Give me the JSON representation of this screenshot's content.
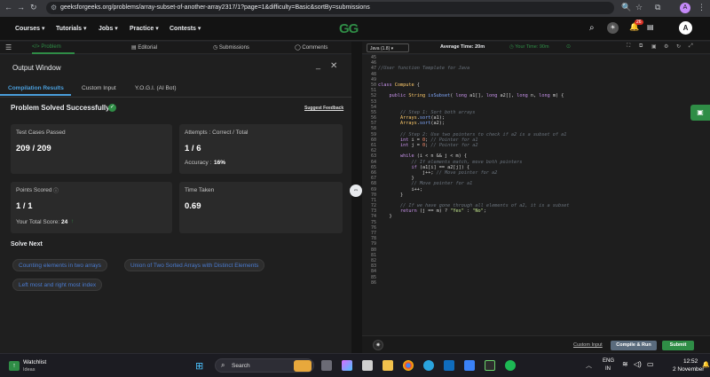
{
  "browser": {
    "url": "geeksforgeeks.org/problems/array-subset-of-another-array2317/1?page=1&difficulty=Basic&sortBy=submissions",
    "profile_initial": "A"
  },
  "site": {
    "logo": "GG",
    "menu": [
      "Courses",
      "Tutorials",
      "Jobs",
      "Practice",
      "Contests"
    ],
    "notification_count": "26",
    "avatar": "A"
  },
  "problem_tabs": [
    "Problem",
    "Editorial",
    "Submissions",
    "Comments"
  ],
  "output": {
    "window_title": "Output Window",
    "tabs": [
      "Compilation Results",
      "Custom Input",
      "Y.O.G.I. (AI Bot)"
    ],
    "status": "Problem Solved Successfully",
    "suggest_feedback": "Suggest Feedback",
    "test_cases_label": "Test Cases Passed",
    "test_cases_value": "209 / 209",
    "attempts_label": "Attempts : Correct / Total",
    "attempts_value": "1 / 6",
    "accuracy_label": "Accuracy :",
    "accuracy_value": "16%",
    "points_label": "Points Scored",
    "points_value": "1 / 1",
    "total_score_label": "Your Total Score:",
    "total_score_value": "24",
    "time_label": "Time Taken",
    "time_value": "0.69",
    "solve_next_title": "Solve Next",
    "solve_next": [
      "Counting elements in two arrays",
      "Union of Two Sorted Arrays with Distinct Elements",
      "Left most and right most index"
    ]
  },
  "editor": {
    "language": "Java (1.8)",
    "average_time": "Average Time: 20m",
    "your_time": "Your Time: 90m",
    "line_numbers": [
      "45",
      "46",
      "47",
      "48",
      "49",
      "50",
      "51",
      "52",
      "53",
      "54",
      "55",
      "56",
      "57",
      "58",
      "59",
      "60",
      "61",
      "62",
      "63",
      "64",
      "65",
      "66",
      "67",
      "68",
      "69",
      "70",
      "71",
      "72",
      "73",
      "74",
      "75",
      "76",
      "77",
      "78",
      "79",
      "80",
      "81",
      "82",
      "83",
      "84",
      "85",
      "86"
    ],
    "lines": [
      "",
      "",
      "//User function Template for Java",
      "",
      "",
      "class Compute {",
      "",
      "    public String isSubset( long a1[], long a2[], long n, long m) {",
      "",
      "",
      "        // Step 1: Sort both arrays",
      "        Arrays.sort(a1);",
      "        Arrays.sort(a2);",
      "",
      "        // Step 2: Use two pointers to check if a2 is a subset of a1",
      "        int i = 0; // Pointer for a1",
      "        int j = 0; // Pointer for a2",
      "",
      "        while (i < n && j < m) {",
      "            // If elements match, move both pointers",
      "            if (a1[i] == a2[j]) {",
      "                j++; // Move pointer for a2",
      "            }",
      "            // Move pointer for a1",
      "            i++;",
      "        }",
      "",
      "        // If we have gone through all elements of a2, it is a subset",
      "        return (j == m) ? \"Yes\" : \"No\";",
      "    }",
      "",
      "",
      "",
      "",
      "",
      "",
      "",
      "",
      "",
      "",
      "",
      ""
    ],
    "custom_input": "Custom Input",
    "compile_run": "Compile & Run",
    "submit": "Submit"
  },
  "taskbar": {
    "widget_title": "Watchlist",
    "widget_subtitle": "Ideas",
    "search": "Search",
    "lang": "ENG",
    "region": "IN",
    "time": "12:52",
    "date": "2 November"
  }
}
